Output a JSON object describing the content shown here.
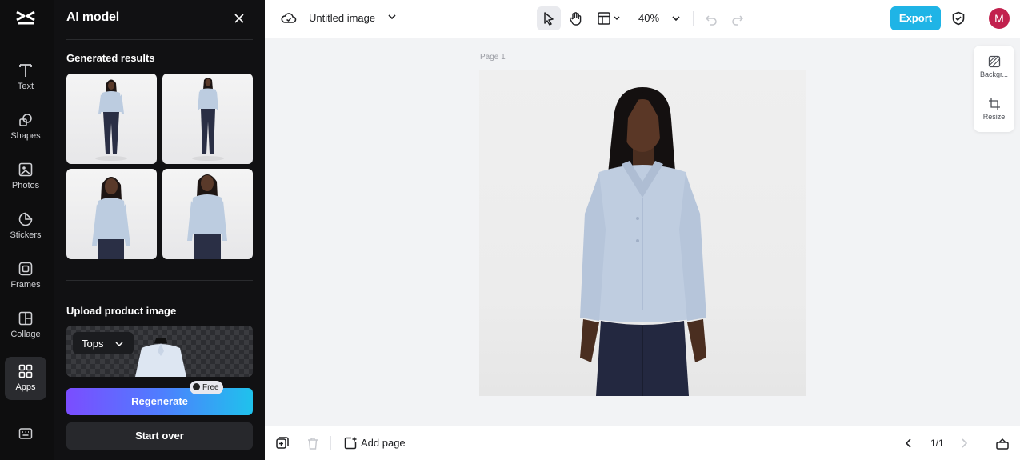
{
  "rail": {
    "items": [
      {
        "label": "Text",
        "icon": "text-icon"
      },
      {
        "label": "Shapes",
        "icon": "shapes-icon"
      },
      {
        "label": "Photos",
        "icon": "photos-icon"
      },
      {
        "label": "Stickers",
        "icon": "stickers-icon"
      },
      {
        "label": "Frames",
        "icon": "frames-icon"
      },
      {
        "label": "Collage",
        "icon": "collage-icon"
      },
      {
        "label": "Apps",
        "icon": "apps-icon",
        "active": true
      }
    ]
  },
  "panel": {
    "title": "AI model",
    "generated_title": "Generated results",
    "upload_title": "Upload product image",
    "category": "Tops",
    "regenerate_label": "Regenerate",
    "free_badge": "Free",
    "start_over_label": "Start over"
  },
  "topbar": {
    "doc_title": "Untitled image",
    "zoom": "40%",
    "export_label": "Export",
    "avatar_letter": "M"
  },
  "canvas": {
    "page_label": "Page 1"
  },
  "side_tools": [
    {
      "label": "Backgr...",
      "icon": "background-icon"
    },
    {
      "label": "Resize",
      "icon": "resize-icon"
    }
  ],
  "bottombar": {
    "add_page_label": "Add page",
    "page_count": "1/1"
  },
  "colors": {
    "accent": "#1fb4e6",
    "avatar": "#c2214e",
    "panel_bg": "#111113",
    "regenerate_gradient": [
      "#7b4dff",
      "#1fc2ec"
    ]
  }
}
